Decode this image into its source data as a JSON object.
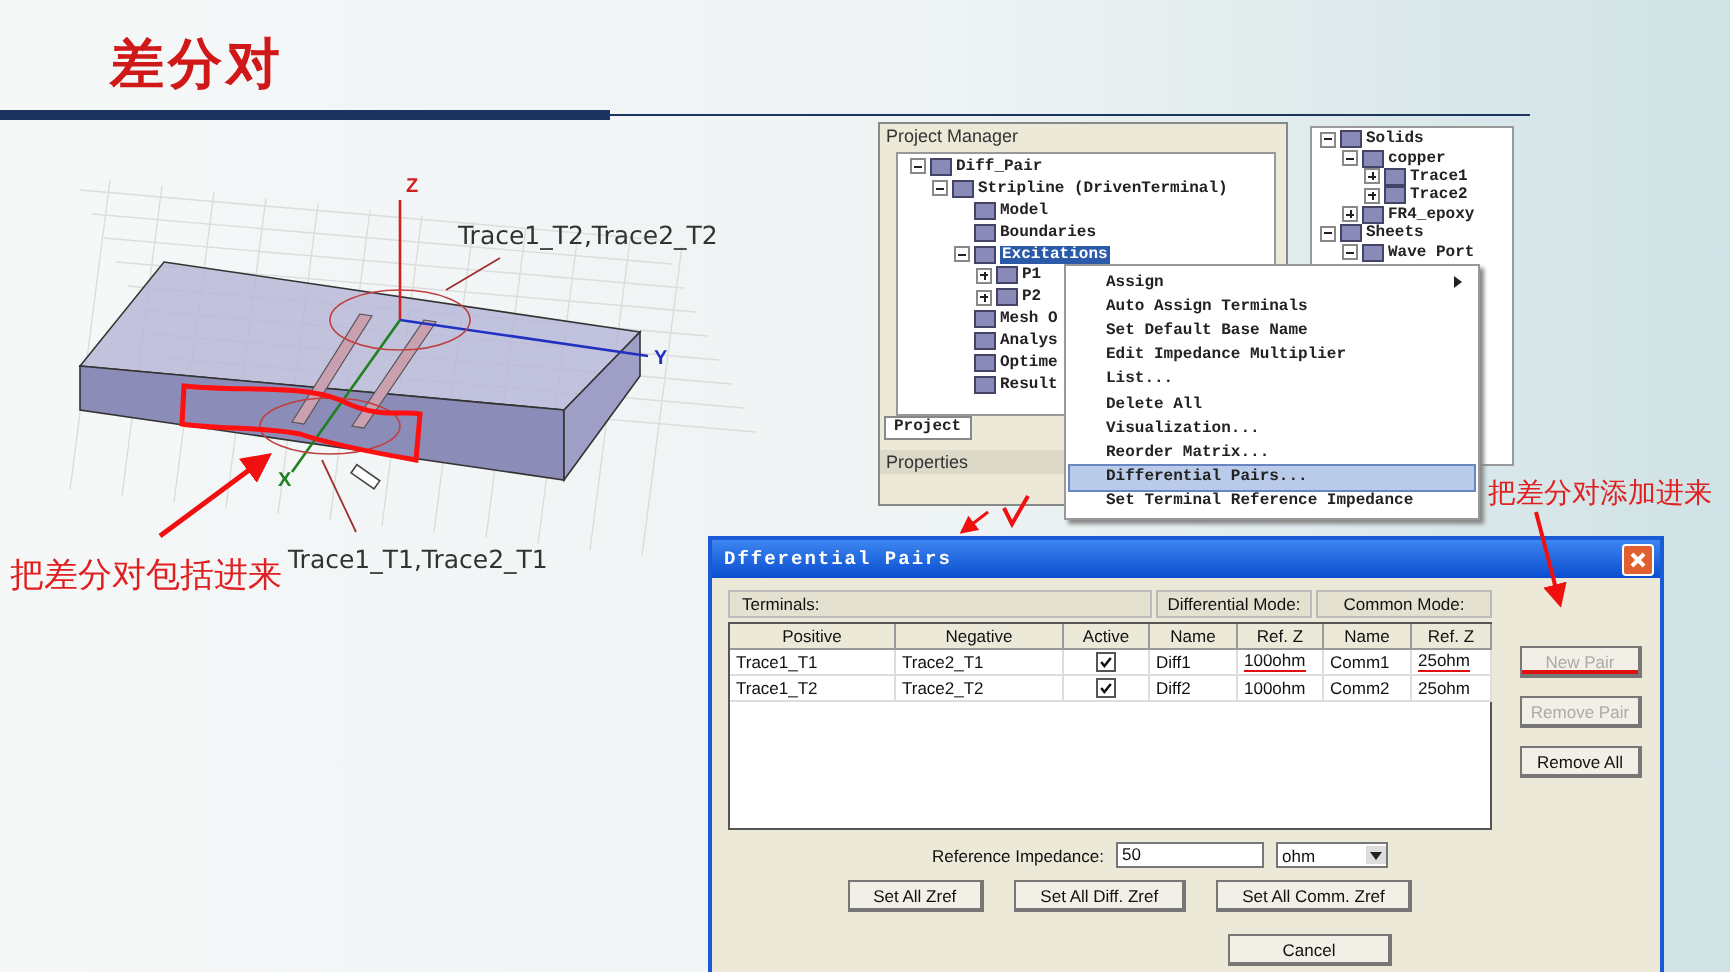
{
  "slide": {
    "title": "差分对"
  },
  "model_view": {
    "axis_labels": [
      "Z",
      "Y",
      "X"
    ],
    "callouts": [
      "Trace1_T2,Trace2_T2",
      "Trace1_T1,Trace2_T1"
    ],
    "note": "把差分对包括进来"
  },
  "project_manager": {
    "title": "Project Manager",
    "tab": "Project",
    "properties_title": "Properties",
    "tree": [
      {
        "label": "Diff_Pair",
        "expanded": true,
        "selected": false,
        "children": [
          {
            "label": "Stripline (DrivenTerminal)",
            "expanded": true,
            "selected": false,
            "children": [
              {
                "label": "Model",
                "selected": false
              },
              {
                "label": "Boundaries",
                "selected": false
              },
              {
                "label": "Excitations",
                "expanded": true,
                "selected": true,
                "children": [
                  {
                    "label": "P1",
                    "expanded": false,
                    "selected": false
                  },
                  {
                    "label": "P2",
                    "expanded": false,
                    "selected": false
                  }
                ]
              },
              {
                "label": "Mesh O",
                "selected": false
              },
              {
                "label": "Analys",
                "selected": false
              },
              {
                "label": "Optime",
                "selected": false
              },
              {
                "label": "Result",
                "selected": false
              }
            ]
          }
        ]
      }
    ]
  },
  "model_tree": {
    "items": [
      {
        "label": "Solids",
        "expanded": true,
        "children": [
          {
            "label": "copper",
            "expanded": true,
            "children": [
              {
                "label": "Trace1",
                "expanded": false
              },
              {
                "label": "Trace2",
                "expanded": false
              }
            ]
          },
          {
            "label": "FR4_epoxy",
            "expanded": false
          }
        ]
      },
      {
        "label": "Sheets",
        "expanded": true,
        "children": [
          {
            "label": "Wave Port",
            "expanded": true
          }
        ]
      }
    ]
  },
  "context_menu": {
    "items": [
      {
        "label": "Assign",
        "submenu": true,
        "selected": false
      },
      {
        "label": "Auto Assign Terminals",
        "submenu": false,
        "selected": false
      },
      {
        "label": "Set Default Base Name",
        "submenu": false,
        "selected": false
      },
      {
        "label": "Edit Impedance Multiplier",
        "submenu": false,
        "selected": false
      },
      {
        "label": "List...",
        "submenu": false,
        "selected": false
      },
      {
        "label": "Delete All",
        "submenu": false,
        "selected": false
      },
      {
        "label": "Visualization...",
        "submenu": false,
        "selected": false
      },
      {
        "label": "Reorder Matrix...",
        "submenu": false,
        "selected": false
      },
      {
        "label": "Differential Pairs...",
        "submenu": false,
        "selected": true
      },
      {
        "label": "Set Terminal Reference Impedance",
        "submenu": false,
        "selected": false
      }
    ]
  },
  "menu_note": "把差分对添加进来",
  "dialog": {
    "title": "Dfferential Pairs",
    "groups": [
      "Terminals:",
      "Differential Mode:",
      "Common Mode:"
    ],
    "columns": [
      "Positive",
      "Negative",
      "Active",
      "Name",
      "Ref. Z",
      "Name",
      "Ref. Z"
    ],
    "rows": [
      {
        "positive": "Trace1_T1",
        "negative": "Trace2_T1",
        "active": true,
        "diff_name": "Diff1",
        "diff_ref_z": "100ohm",
        "comm_name": "Comm1",
        "comm_ref_z": "25ohm",
        "marked": true
      },
      {
        "positive": "Trace1_T2",
        "negative": "Trace2_T2",
        "active": true,
        "diff_name": "Diff2",
        "diff_ref_z": "100ohm",
        "comm_name": "Comm2",
        "comm_ref_z": "25ohm",
        "marked": false
      }
    ],
    "side_buttons": [
      {
        "label": "New Pair",
        "disabled": true,
        "marked": true
      },
      {
        "label": "Remove Pair",
        "disabled": true,
        "marked": false
      },
      {
        "label": "Remove All",
        "disabled": false,
        "marked": false
      }
    ],
    "reference_impedance": {
      "label": "Reference Impedance:",
      "value": "50",
      "unit": "ohm"
    },
    "set_buttons": [
      "Set All Zref",
      "Set All Diff. Zref",
      "Set All Comm. Zref"
    ],
    "cancel": "Cancel"
  }
}
